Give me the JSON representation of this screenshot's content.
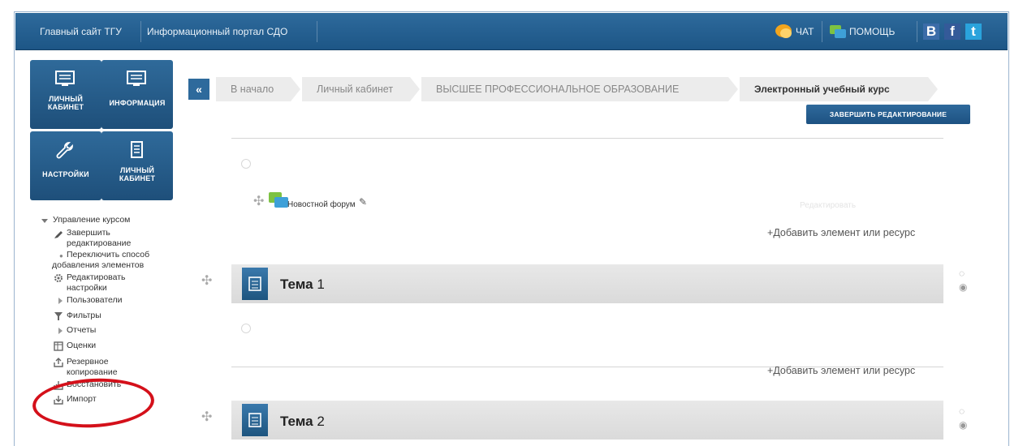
{
  "topbar": {
    "site_link": "Главный сайт ТГУ",
    "portal_link": "Информационный портал СДО",
    "chat": "ЧАТ",
    "help": "ПОМОЩЬ",
    "social_vk": "B",
    "social_fb": "f",
    "social_tw": "t"
  },
  "tiles": {
    "cabinet1": [
      "ЛИЧНЫЙ",
      "КАБИНЕТ"
    ],
    "info": "ИНФОРМАЦИЯ",
    "settings": "НАСТРОЙКИ",
    "cabinet2": [
      "ЛИЧНЫЙ",
      "КАБИНЕТ"
    ]
  },
  "menu": {
    "course_admin": "Управление курсом",
    "finish_edit": [
      "Завершить",
      "редактирование"
    ],
    "switch_mode": [
      "Переключить способ",
      "добавления элементов"
    ],
    "edit_settings": [
      "Редактировать",
      "настройки"
    ],
    "users": "Пользователи",
    "filters": "Фильтры",
    "reports": "Отчеты",
    "grades": "Оценки",
    "backup": [
      "Резервное",
      "копирование"
    ],
    "restore": "Восстановить",
    "import": "Импорт"
  },
  "breadcrumb": {
    "home": "В начало",
    "cabinet": "Личный кабинет",
    "higher_ed": "ВЫСШЕЕ ПРОФЕССИОНАЛЬНОЕ ОБРАЗОВАНИЕ",
    "course": "Электронный учебный курс"
  },
  "finish_button": "ЗАВЕРШИТЬ РЕДАКТИРОВАНИЕ",
  "forum": {
    "name": "Новостной форум",
    "ghost_label": "Редактировать"
  },
  "add_resource": "Добавить элемент или ресурс",
  "topics": [
    {
      "word": "Тема",
      "num": "1"
    },
    {
      "word": "Тема",
      "num": "2"
    }
  ],
  "colors": {
    "brand_blue": "#1d5686",
    "highlight_red": "#d4101a"
  }
}
